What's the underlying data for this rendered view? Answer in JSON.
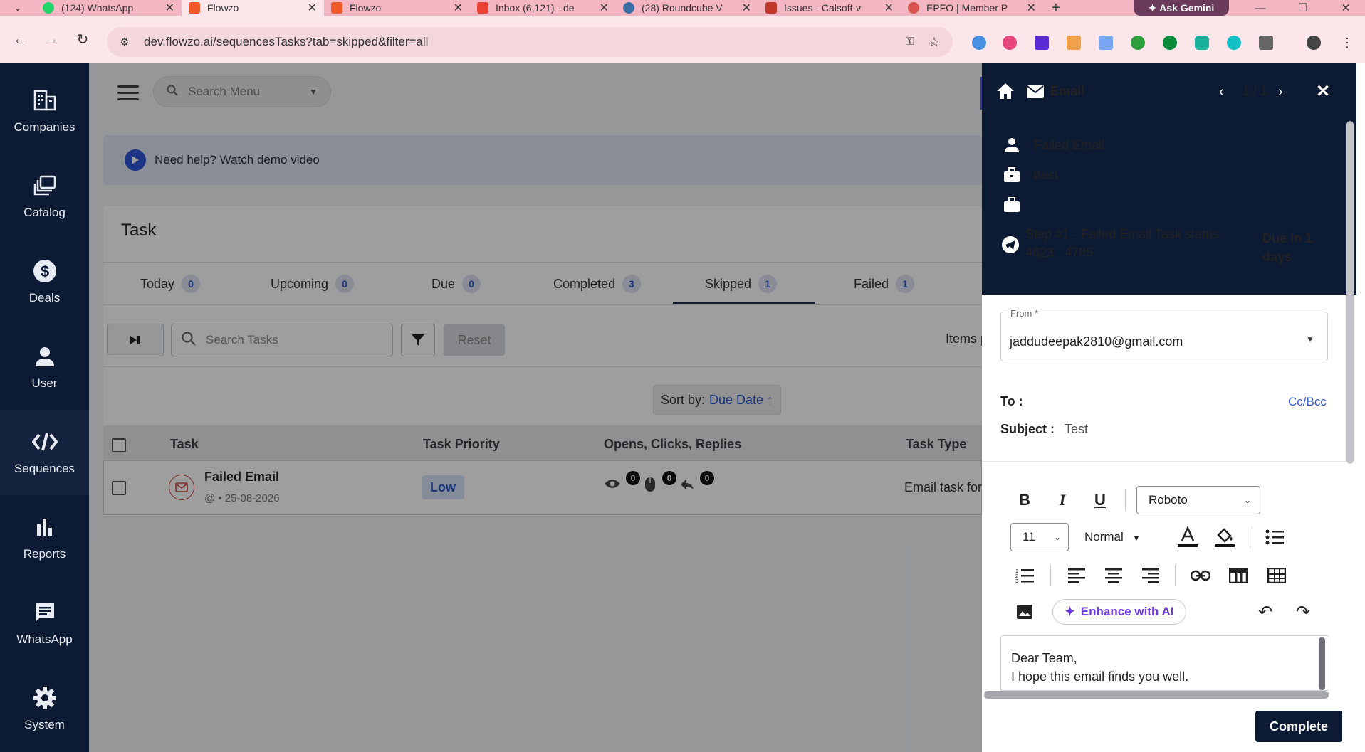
{
  "browser": {
    "tabs": [
      {
        "title": "(124) WhatsApp",
        "color": "#25d366"
      },
      {
        "title": "Flowzo",
        "color": "#f05a28",
        "active": true
      },
      {
        "title": "Flowzo",
        "color": "#f05a28"
      },
      {
        "title": "Inbox (6,121) - de",
        "color": "#ea4335"
      },
      {
        "title": "(28) Roundcube V",
        "color": "#3b6ea5"
      },
      {
        "title": "Issues - Calsoft-v",
        "color": "#c0392b"
      },
      {
        "title": "EPFO | Member P",
        "color": "#d9534f"
      }
    ],
    "gemini_label": "Ask Gemini",
    "url": "dev.flowzo.ai/sequencesTasks?tab=skipped&filter=all"
  },
  "sidebar": {
    "items": [
      {
        "label": "Companies",
        "icon": "building-icon"
      },
      {
        "label": "Catalog",
        "icon": "catalog-icon"
      },
      {
        "label": "Deals",
        "icon": "dollar-icon"
      },
      {
        "label": "User",
        "icon": "user-icon"
      },
      {
        "label": "Sequences",
        "icon": "sequences-icon",
        "active": true
      },
      {
        "label": "Reports",
        "icon": "bar-chart-icon"
      },
      {
        "label": "WhatsApp",
        "icon": "chat-icon"
      },
      {
        "label": "System",
        "icon": "gear-icon"
      }
    ]
  },
  "topbar": {
    "search_placeholder": "Search Menu"
  },
  "help": {
    "text": "Need help? Watch demo video"
  },
  "task": {
    "title": "Task",
    "tabs": [
      {
        "label": "Today",
        "count": "0"
      },
      {
        "label": "Upcoming",
        "count": "0"
      },
      {
        "label": "Due",
        "count": "0"
      },
      {
        "label": "Completed",
        "count": "3"
      },
      {
        "label": "Skipped",
        "count": "1",
        "active": true
      },
      {
        "label": "Failed",
        "count": "1"
      }
    ],
    "search_placeholder": "Search Tasks",
    "reset_label": "Reset",
    "items_label": "Items p",
    "sort_label": "Sort by:",
    "sort_value": "Due Date ↑",
    "columns": [
      "Task",
      "Task Priority",
      "Opens, Clicks, Replies",
      "Task Type"
    ],
    "rows": [
      {
        "name": "Failed Email",
        "meta": "@ • 25-08-2026",
        "priority": "Low",
        "opens": "0",
        "clicks": "0",
        "replies": "0",
        "type": "Email task for"
      }
    ]
  },
  "panel": {
    "title": "Email",
    "pager": "1 / 1",
    "contact": "Failed Email",
    "company": "ttest",
    "step": "Step #1 - Failed Email Task status - 4623 , 4785",
    "due": "Due in 1 days",
    "from_label": "From *",
    "from_value": "jaddudeepak2810@gmail.com",
    "to_label": "To :",
    "cc_label": "Cc/Bcc",
    "subject_label": "Subject :",
    "subject_value": "Test",
    "font": "Roboto",
    "size": "11",
    "style": "Normal",
    "enhance_label": "Enhance with AI",
    "body_line1": "Dear Team,",
    "body_line2": "I hope this email finds you well.",
    "complete_label": "Complete"
  }
}
